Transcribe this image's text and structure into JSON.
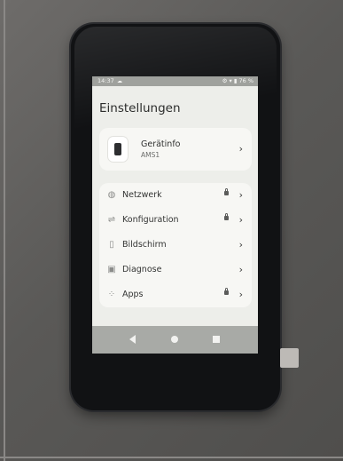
{
  "status_bar": {
    "time": "14:37",
    "right_text": "76 %",
    "icons": [
      "cloud-icon",
      "wifi-icon",
      "signal-icon",
      "battery-icon"
    ]
  },
  "page": {
    "title": "Einstellungen"
  },
  "device_info": {
    "title": "Gerätinfo",
    "subtitle": "AMS1",
    "icon": "phone-icon"
  },
  "menu": {
    "items": [
      {
        "label": "Netzwerk",
        "icon": "globe-icon",
        "locked": true
      },
      {
        "label": "Konfiguration",
        "icon": "sliders-icon",
        "locked": true
      },
      {
        "label": "Bildschirm",
        "icon": "display-icon",
        "locked": false
      },
      {
        "label": "Diagnose",
        "icon": "diagnostics-icon",
        "locked": false
      },
      {
        "label": "Apps",
        "icon": "apps-grid-icon",
        "locked": true
      }
    ]
  },
  "nav_bar": {
    "buttons": [
      "back-icon",
      "home-icon",
      "recents-icon"
    ]
  },
  "colors": {
    "screen_background": "#edeeea",
    "card_background": "#f7f7f4",
    "device_bezel": "#111214",
    "nav_bar": "#a8aaa6"
  }
}
